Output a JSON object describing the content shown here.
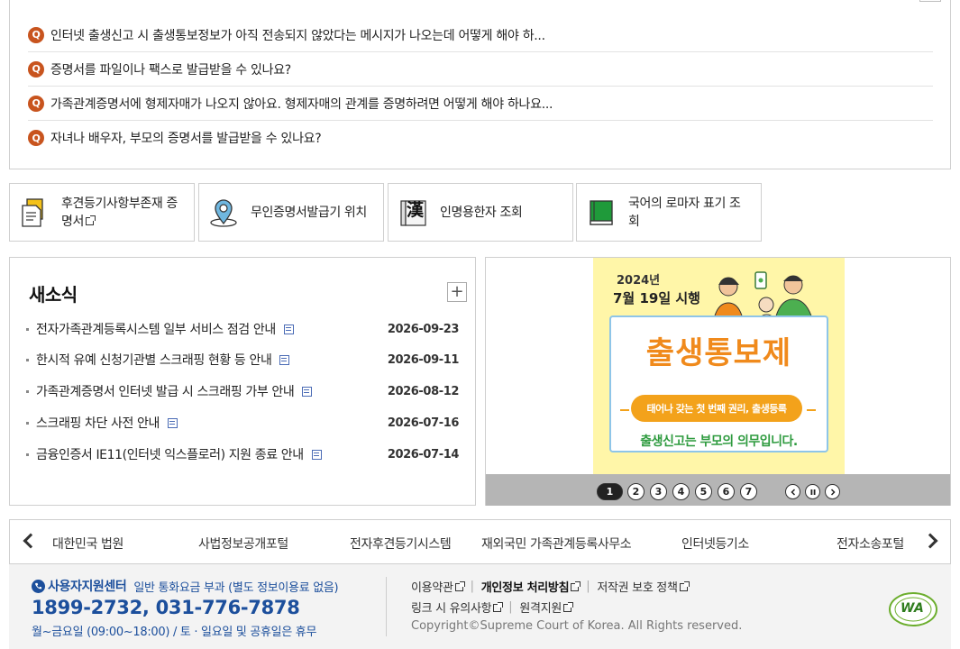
{
  "faq": {
    "items": [
      "인터넷 출생신고 시 출생통보정보가 아직 전송되지 않았다는 메시지가 나오는데 어떻게 해야 하...",
      "증명서를 파일이나 팩스로 발급받을 수 있나요?",
      "가족관계증명서에 형제자매가 나오지 않아요. 형제자매의 관계를 증명하려면 어떻게 해야 하나요...",
      "자녀나 배우자, 부모의 증명서를 발급받을 수 있나요?"
    ],
    "badge": "Q"
  },
  "quick": [
    {
      "line1": "후견등기사항부존재 증",
      "line2": "명서",
      "icon": "certificate-doc-icon",
      "external": true
    },
    {
      "line1": "무인증명서발급기 위치",
      "line2": "",
      "icon": "location-pin-icon",
      "external": false
    },
    {
      "line1": "인명용한자 조회",
      "line2": "",
      "icon": "hanja-book-icon",
      "glyph": "漢",
      "external": false
    },
    {
      "line1": "국어의 로마자 표기 조",
      "line2": "회",
      "icon": "green-book-icon",
      "external": false
    }
  ],
  "news": {
    "title": "새소식",
    "more": "+",
    "items": [
      {
        "title": "전자가족관계등록시스템 일부 서비스 점검 안내",
        "date": "2026-09-23"
      },
      {
        "title": "한시적 유예 신청기관별 스크래핑 현황 등 안내",
        "date": "2026-09-11"
      },
      {
        "title": "가족관계증명서 인터넷 발급 시 스크래핑 가부 안내",
        "date": "2026-08-12"
      },
      {
        "title": "스크래핑 차단 사전 안내",
        "date": "2026-07-16"
      },
      {
        "title": "금융인증서 IE11(인터넷 익스플로러) 지원 종료 안내",
        "date": "2026-07-14"
      }
    ]
  },
  "banner": {
    "year": "2024년",
    "date_text": "7월 19일 시행",
    "title": "출생통보제",
    "pill": "태어나 갖는 첫 번째 권리, 출생등록",
    "slogan": "출생신고는 부모의 의무입니다.",
    "pages": [
      "1",
      "2",
      "3",
      "4",
      "5",
      "6",
      "7"
    ],
    "active_page": "1",
    "colors": {
      "bg": "#fff6a8",
      "title": "#f08a1c",
      "pill": "#f3a21b",
      "slogan": "#2e9b3f"
    }
  },
  "family": [
    "대한민국 법원",
    "사법정보공개포털",
    "전자후견등기시스템",
    "재외국민 가족관계등록사무소",
    "인터넷등기소",
    "전자소송포털"
  ],
  "footer": {
    "center_label": "사용자지원센터",
    "center_note": "일반 통화요금 부과 (별도 정보이용료 없음)",
    "phone": "1899-2732, 031-776-7878",
    "hours": "월~금요일 (09:00~18:00) / 토 · 일요일 및 공휴일은 휴무",
    "links_row1": [
      "이용약관",
      "개인정보 처리방침",
      "저작권 보호 정책"
    ],
    "links_row2": [
      "링크 시 유의사항",
      "원격지원"
    ],
    "copyright": "Copyright©Supreme Court of Korea. All Rights reserved.",
    "wa_mark": "WA",
    "accent": "#1c4f9c"
  }
}
